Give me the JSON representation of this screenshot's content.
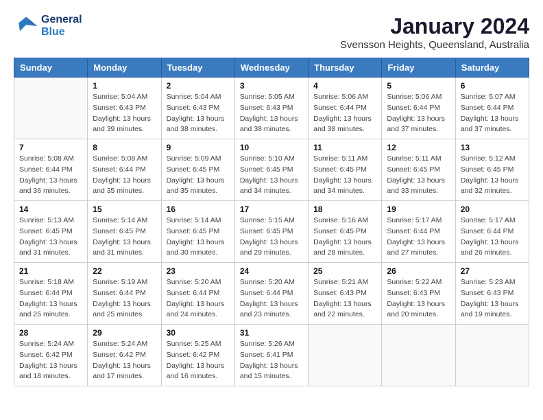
{
  "header": {
    "logo_line1": "General",
    "logo_line2": "Blue",
    "main_title": "January 2024",
    "subtitle": "Svensson Heights, Queensland, Australia"
  },
  "days_of_week": [
    "Sunday",
    "Monday",
    "Tuesday",
    "Wednesday",
    "Thursday",
    "Friday",
    "Saturday"
  ],
  "weeks": [
    [
      {
        "day": "",
        "sunrise": "",
        "sunset": "",
        "daylight": "",
        "empty": true
      },
      {
        "day": "1",
        "sunrise": "Sunrise: 5:04 AM",
        "sunset": "Sunset: 6:43 PM",
        "daylight": "Daylight: 13 hours and 39 minutes."
      },
      {
        "day": "2",
        "sunrise": "Sunrise: 5:04 AM",
        "sunset": "Sunset: 6:43 PM",
        "daylight": "Daylight: 13 hours and 38 minutes."
      },
      {
        "day": "3",
        "sunrise": "Sunrise: 5:05 AM",
        "sunset": "Sunset: 6:43 PM",
        "daylight": "Daylight: 13 hours and 38 minutes."
      },
      {
        "day": "4",
        "sunrise": "Sunrise: 5:06 AM",
        "sunset": "Sunset: 6:44 PM",
        "daylight": "Daylight: 13 hours and 38 minutes."
      },
      {
        "day": "5",
        "sunrise": "Sunrise: 5:06 AM",
        "sunset": "Sunset: 6:44 PM",
        "daylight": "Daylight: 13 hours and 37 minutes."
      },
      {
        "day": "6",
        "sunrise": "Sunrise: 5:07 AM",
        "sunset": "Sunset: 6:44 PM",
        "daylight": "Daylight: 13 hours and 37 minutes."
      }
    ],
    [
      {
        "day": "7",
        "sunrise": "Sunrise: 5:08 AM",
        "sunset": "Sunset: 6:44 PM",
        "daylight": "Daylight: 13 hours and 36 minutes."
      },
      {
        "day": "8",
        "sunrise": "Sunrise: 5:08 AM",
        "sunset": "Sunset: 6:44 PM",
        "daylight": "Daylight: 13 hours and 35 minutes."
      },
      {
        "day": "9",
        "sunrise": "Sunrise: 5:09 AM",
        "sunset": "Sunset: 6:45 PM",
        "daylight": "Daylight: 13 hours and 35 minutes."
      },
      {
        "day": "10",
        "sunrise": "Sunrise: 5:10 AM",
        "sunset": "Sunset: 6:45 PM",
        "daylight": "Daylight: 13 hours and 34 minutes."
      },
      {
        "day": "11",
        "sunrise": "Sunrise: 5:11 AM",
        "sunset": "Sunset: 6:45 PM",
        "daylight": "Daylight: 13 hours and 34 minutes."
      },
      {
        "day": "12",
        "sunrise": "Sunrise: 5:11 AM",
        "sunset": "Sunset: 6:45 PM",
        "daylight": "Daylight: 13 hours and 33 minutes."
      },
      {
        "day": "13",
        "sunrise": "Sunrise: 5:12 AM",
        "sunset": "Sunset: 6:45 PM",
        "daylight": "Daylight: 13 hours and 32 minutes."
      }
    ],
    [
      {
        "day": "14",
        "sunrise": "Sunrise: 5:13 AM",
        "sunset": "Sunset: 6:45 PM",
        "daylight": "Daylight: 13 hours and 31 minutes."
      },
      {
        "day": "15",
        "sunrise": "Sunrise: 5:14 AM",
        "sunset": "Sunset: 6:45 PM",
        "daylight": "Daylight: 13 hours and 31 minutes."
      },
      {
        "day": "16",
        "sunrise": "Sunrise: 5:14 AM",
        "sunset": "Sunset: 6:45 PM",
        "daylight": "Daylight: 13 hours and 30 minutes."
      },
      {
        "day": "17",
        "sunrise": "Sunrise: 5:15 AM",
        "sunset": "Sunset: 6:45 PM",
        "daylight": "Daylight: 13 hours and 29 minutes."
      },
      {
        "day": "18",
        "sunrise": "Sunrise: 5:16 AM",
        "sunset": "Sunset: 6:45 PM",
        "daylight": "Daylight: 13 hours and 28 minutes."
      },
      {
        "day": "19",
        "sunrise": "Sunrise: 5:17 AM",
        "sunset": "Sunset: 6:44 PM",
        "daylight": "Daylight: 13 hours and 27 minutes."
      },
      {
        "day": "20",
        "sunrise": "Sunrise: 5:17 AM",
        "sunset": "Sunset: 6:44 PM",
        "daylight": "Daylight: 13 hours and 26 minutes."
      }
    ],
    [
      {
        "day": "21",
        "sunrise": "Sunrise: 5:18 AM",
        "sunset": "Sunset: 6:44 PM",
        "daylight": "Daylight: 13 hours and 25 minutes."
      },
      {
        "day": "22",
        "sunrise": "Sunrise: 5:19 AM",
        "sunset": "Sunset: 6:44 PM",
        "daylight": "Daylight: 13 hours and 25 minutes."
      },
      {
        "day": "23",
        "sunrise": "Sunrise: 5:20 AM",
        "sunset": "Sunset: 6:44 PM",
        "daylight": "Daylight: 13 hours and 24 minutes."
      },
      {
        "day": "24",
        "sunrise": "Sunrise: 5:20 AM",
        "sunset": "Sunset: 6:44 PM",
        "daylight": "Daylight: 13 hours and 23 minutes."
      },
      {
        "day": "25",
        "sunrise": "Sunrise: 5:21 AM",
        "sunset": "Sunset: 6:43 PM",
        "daylight": "Daylight: 13 hours and 22 minutes."
      },
      {
        "day": "26",
        "sunrise": "Sunrise: 5:22 AM",
        "sunset": "Sunset: 6:43 PM",
        "daylight": "Daylight: 13 hours and 20 minutes."
      },
      {
        "day": "27",
        "sunrise": "Sunrise: 5:23 AM",
        "sunset": "Sunset: 6:43 PM",
        "daylight": "Daylight: 13 hours and 19 minutes."
      }
    ],
    [
      {
        "day": "28",
        "sunrise": "Sunrise: 5:24 AM",
        "sunset": "Sunset: 6:42 PM",
        "daylight": "Daylight: 13 hours and 18 minutes."
      },
      {
        "day": "29",
        "sunrise": "Sunrise: 5:24 AM",
        "sunset": "Sunset: 6:42 PM",
        "daylight": "Daylight: 13 hours and 17 minutes."
      },
      {
        "day": "30",
        "sunrise": "Sunrise: 5:25 AM",
        "sunset": "Sunset: 6:42 PM",
        "daylight": "Daylight: 13 hours and 16 minutes."
      },
      {
        "day": "31",
        "sunrise": "Sunrise: 5:26 AM",
        "sunset": "Sunset: 6:41 PM",
        "daylight": "Daylight: 13 hours and 15 minutes."
      },
      {
        "day": "",
        "sunrise": "",
        "sunset": "",
        "daylight": "",
        "empty": true
      },
      {
        "day": "",
        "sunrise": "",
        "sunset": "",
        "daylight": "",
        "empty": true
      },
      {
        "day": "",
        "sunrise": "",
        "sunset": "",
        "daylight": "",
        "empty": true
      }
    ]
  ]
}
